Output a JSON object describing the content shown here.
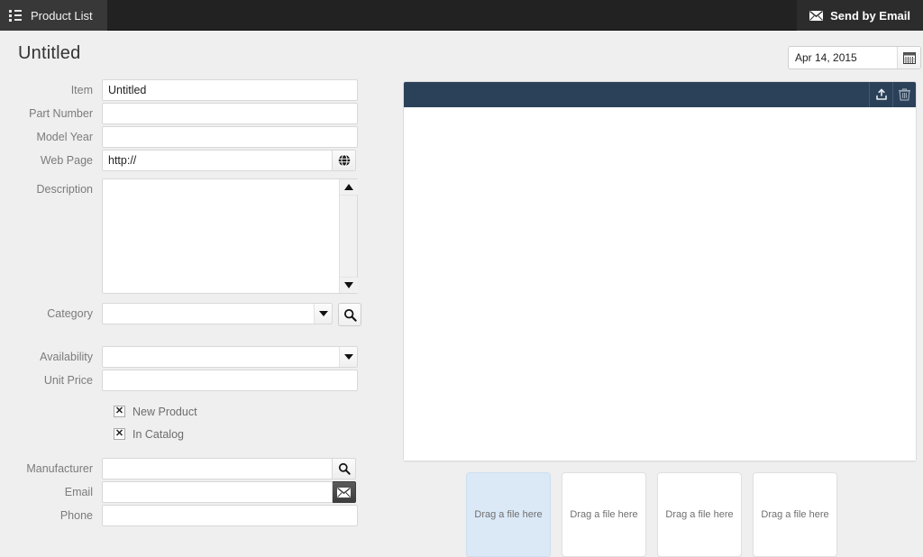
{
  "topbar": {
    "product_list_label": "Product List",
    "product_list_icon": "list-icon",
    "send_email_label": "Send by Email",
    "send_email_icon": "envelope-icon",
    "bg_color": "#222222"
  },
  "header": {
    "title": "Untitled",
    "date_value": "Apr 14, 2015",
    "calendar_icon": "calendar-icon"
  },
  "form": {
    "item": {
      "label": "Item",
      "value": "Untitled"
    },
    "part_number": {
      "label": "Part Number",
      "value": ""
    },
    "model_year": {
      "label": "Model Year",
      "value": ""
    },
    "web_page": {
      "label": "Web Page",
      "value": "http://",
      "button_icon": "globe-icon"
    },
    "description": {
      "label": "Description",
      "value": "",
      "scroll_up_icon": "triangle-up-icon",
      "scroll_down_icon": "triangle-down-icon"
    },
    "category": {
      "label": "Category",
      "value": "",
      "dropdown_icon": "chevron-down-icon",
      "search_icon": "search-icon"
    },
    "availability": {
      "label": "Availability",
      "value": "",
      "dropdown_icon": "chevron-down-icon"
    },
    "unit_price": {
      "label": "Unit Price",
      "value": ""
    },
    "new_product": {
      "label": "New Product",
      "checked": true,
      "mark": "✕"
    },
    "in_catalog": {
      "label": "In Catalog",
      "checked": true,
      "mark": "✕"
    },
    "manufacturer": {
      "label": "Manufacturer",
      "value": "",
      "button_icon": "search-icon"
    },
    "email": {
      "label": "Email",
      "value": "",
      "button_icon": "envelope-icon"
    },
    "phone": {
      "label": "Phone",
      "value": ""
    }
  },
  "right_panel": {
    "header_color": "#2b4159",
    "upload_icon": "upload-icon",
    "delete_icon": "trash-icon",
    "content": ""
  },
  "dropzones": [
    {
      "label": "Drag a file here",
      "active": true
    },
    {
      "label": "Drag a file here",
      "active": false
    },
    {
      "label": "Drag a file here",
      "active": false
    },
    {
      "label": "Drag a file here",
      "active": false
    }
  ],
  "colors": {
    "page_bg": "#efefef",
    "topbar_bg": "#222222",
    "panel_header": "#2b4159",
    "dropzone_active": "#dbe9f7",
    "label_text": "#7b7b7b"
  }
}
